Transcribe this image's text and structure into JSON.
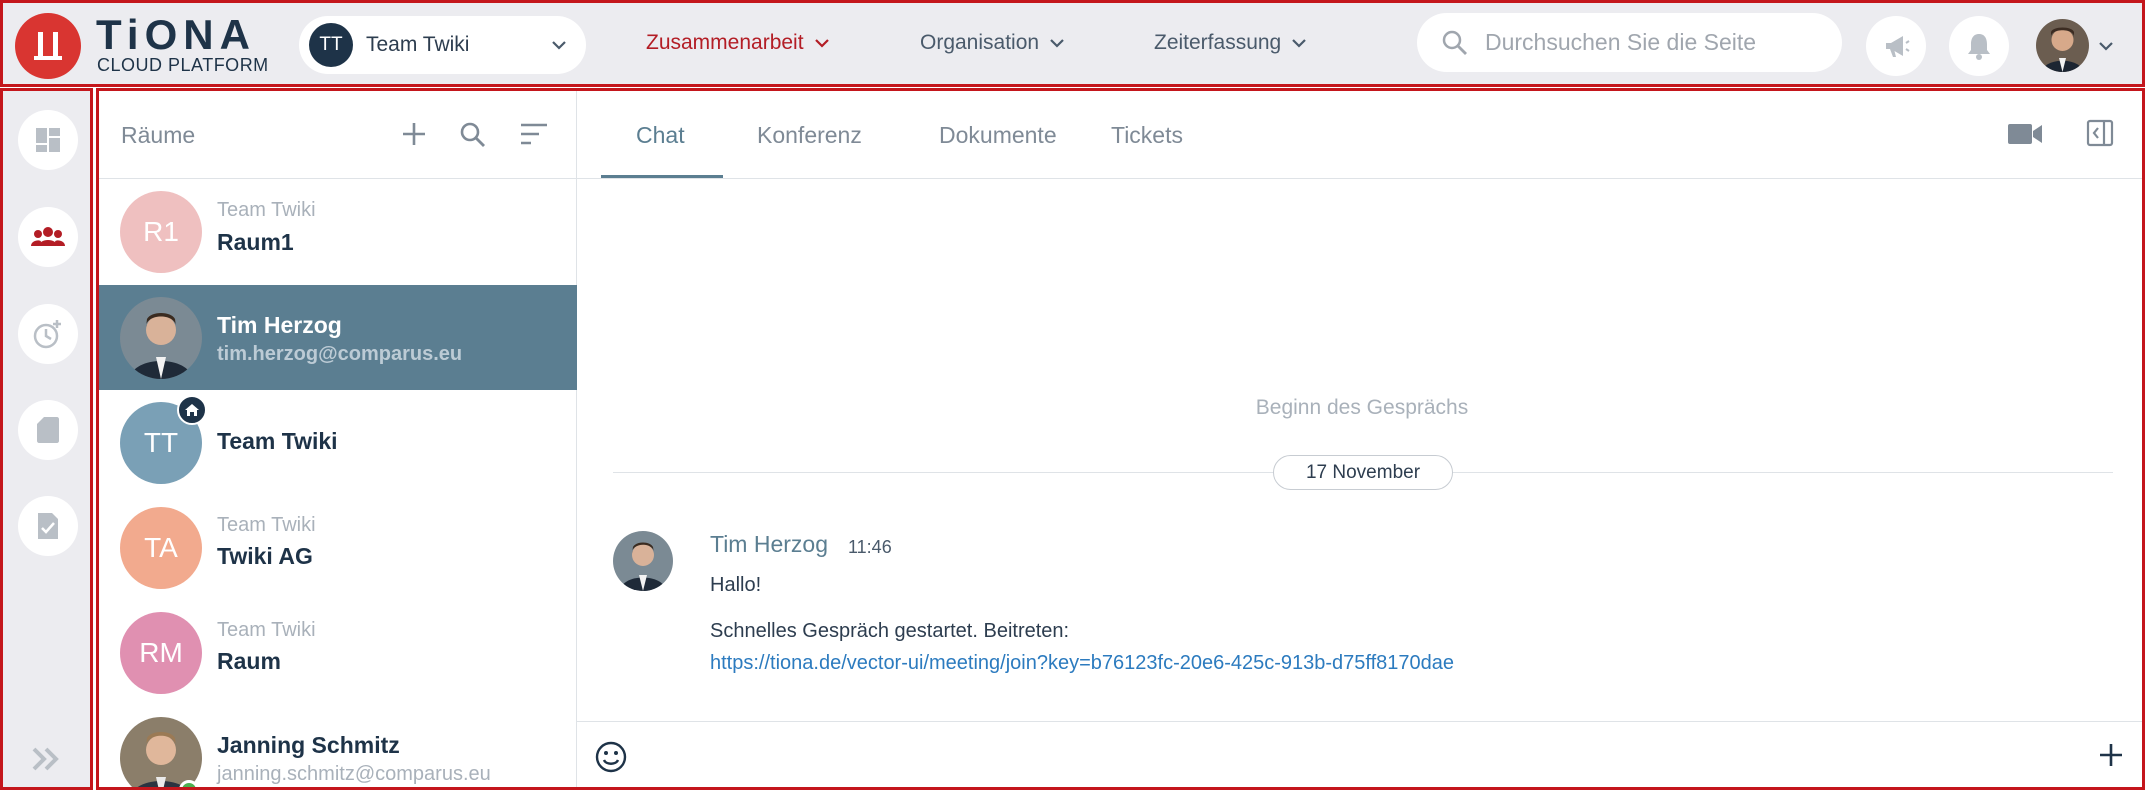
{
  "brand": {
    "name": "TiONA",
    "subtitle": "CLOUD PLATFORM"
  },
  "team_selector": {
    "initials": "TT",
    "name": "Team Twiki"
  },
  "nav": [
    {
      "label": "Zusammenarbeit",
      "active": true
    },
    {
      "label": "Organisation",
      "active": false
    },
    {
      "label": "Zeiterfassung",
      "active": false
    }
  ],
  "search": {
    "placeholder": "Durchsuchen Sie die Seite"
  },
  "header_icons": [
    "megaphone-icon",
    "bell-icon",
    "profile-avatar",
    "chevron-down-icon"
  ],
  "rail": {
    "items": [
      "dashboard-icon",
      "team-icon",
      "time-tracking-icon",
      "document-icon",
      "task-check-icon",
      "expand-icon"
    ]
  },
  "rooms": {
    "title": "Räume",
    "items": [
      {
        "initials": "R1",
        "sub": "Team Twiki",
        "name": "Raum1",
        "color": "#efc0c0"
      },
      {
        "initials": "",
        "sub": "tim.herzog@comparus.eu",
        "name": "Tim Herzog",
        "selected": true
      },
      {
        "initials": "TT",
        "sub": "",
        "name": "Team Twiki",
        "color": "#7aa0b6",
        "home": true
      },
      {
        "initials": "TA",
        "sub": "Team Twiki",
        "name": "Twiki AG",
        "color": "#f2aa8e"
      },
      {
        "initials": "RM",
        "sub": "Team Twiki",
        "name": "Raum",
        "color": "#e090b1"
      },
      {
        "initials": "",
        "sub": "janning.schmitz@comparus.eu",
        "name": "Janning Schmitz",
        "online": true
      }
    ]
  },
  "tabs": [
    {
      "label": "Chat",
      "active": true
    },
    {
      "label": "Konferenz"
    },
    {
      "label": "Dokumente"
    },
    {
      "label": "Tickets"
    }
  ],
  "chat": {
    "begin": "Beginn des Gesprächs",
    "date": "17 November",
    "message": {
      "author": "Tim Herzog",
      "time": "11:46",
      "line1": "Hallo!",
      "line2": "Schnelles Gespräch gestartet. Beitreten:",
      "link": "https://tiona.de/vector-ui/meeting/join?key=b76123fc-20e6-425c-913b-d75ff8170dae"
    }
  },
  "colors": {
    "accent": "#b31d25",
    "selected": "#5b7e91",
    "brand_red": "#d93531",
    "navy": "#1e3348"
  }
}
